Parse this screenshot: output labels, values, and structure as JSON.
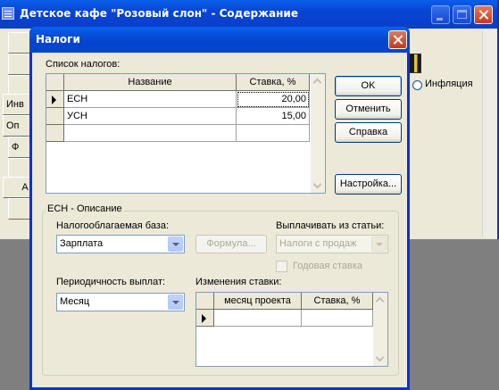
{
  "main_window": {
    "title": "Детское кафе \"Розовый слон\" - Содержание",
    "left_buttons": [
      "",
      "",
      "",
      "Инв",
      "Оп",
      "Ф",
      "",
      "А",
      ""
    ],
    "inflation_label": "Инфляция"
  },
  "dialog": {
    "title": "Налоги",
    "tax_list_label": "Список налогов:",
    "tax_table": {
      "columns": [
        "Название",
        "Ставка, %"
      ],
      "rows": [
        {
          "name": "ЕСН",
          "rate": "20,00"
        },
        {
          "name": "УСН",
          "rate": "15,00"
        },
        {
          "name": "",
          "rate": ""
        }
      ]
    },
    "buttons": {
      "ok": "OK",
      "cancel": "Отменить",
      "help": "Справка",
      "settings": "Настройка..."
    },
    "description_group_title": "ЕСН - Описание",
    "tax_base_label": "Налогооблагаемая база:",
    "tax_base_value": "Зарплата",
    "formula_button": "Формула...",
    "pay_from_label": "Выплачивать из статьи:",
    "pay_from_value": "Налоги с продаж",
    "annual_rate_label": "Годовая ставка",
    "periodicity_label": "Периодичность выплат:",
    "periodicity_value": "Месяц",
    "rate_changes_label": "Изменения ставки:",
    "rate_changes_table": {
      "columns": [
        "месяц проекта",
        "Ставка, %"
      ]
    }
  },
  "colors": {
    "title_blue": "#0a5fea",
    "face": "#ece9d8",
    "desktop": "#7f7f7f",
    "close_red": "#c83a1f"
  }
}
